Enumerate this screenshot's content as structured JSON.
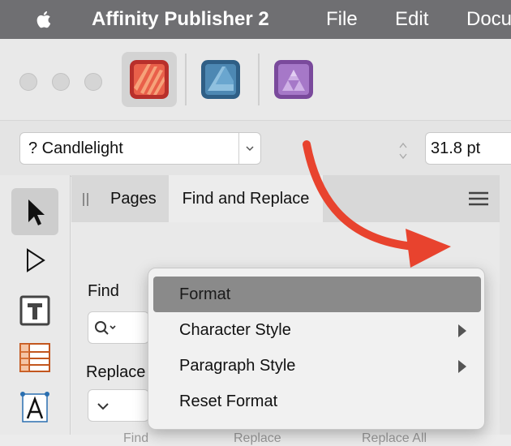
{
  "menubar": {
    "app_name": "Affinity Publisher 2",
    "items": [
      "File",
      "Edit",
      "Docu"
    ]
  },
  "toolbar": {
    "personas": [
      {
        "name": "Publisher",
        "icon": "publisher-persona-icon",
        "color": "#c0302a"
      },
      {
        "name": "Designer",
        "icon": "designer-persona-icon",
        "color": "#3b6f95"
      },
      {
        "name": "Photo",
        "icon": "photo-persona-icon",
        "color": "#8a5aa8"
      }
    ]
  },
  "context": {
    "font_name": "? Candlelight",
    "font_size": "31.8 pt"
  },
  "panel": {
    "tabs": [
      "Pages",
      "Find and Replace"
    ],
    "find_label": "Find",
    "replace_label": "Replace with",
    "bottom_buttons": [
      "Find",
      "Replace",
      "Replace All"
    ]
  },
  "popup": {
    "items": [
      {
        "label": "Format",
        "highlighted": true,
        "submenu": false
      },
      {
        "label": "Character Style",
        "highlighted": false,
        "submenu": true
      },
      {
        "label": "Paragraph Style",
        "highlighted": false,
        "submenu": true
      },
      {
        "label": "Reset Format",
        "highlighted": false,
        "submenu": false
      }
    ]
  },
  "colors": {
    "annotation_arrow": "#e8432e",
    "menu_highlight": "#8a8a8a"
  }
}
